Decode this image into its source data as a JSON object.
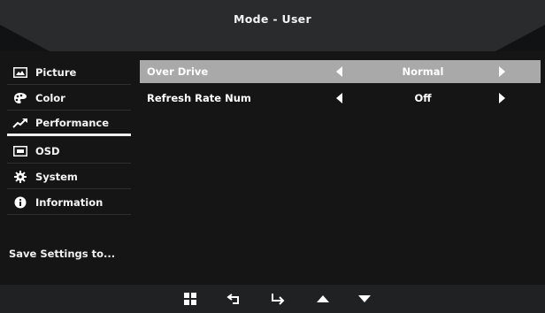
{
  "header": {
    "title": "Mode - User"
  },
  "sidebar": {
    "items": [
      {
        "label": "Picture",
        "icon": "picture-icon"
      },
      {
        "label": "Color",
        "icon": "palette-icon"
      },
      {
        "label": "Performance",
        "icon": "trend-up-icon",
        "active": true
      },
      {
        "label": "OSD",
        "icon": "osd-icon"
      },
      {
        "label": "System",
        "icon": "gear-icon"
      },
      {
        "label": "Information",
        "icon": "info-icon"
      }
    ],
    "save_settings": "Save Settings to..."
  },
  "main": {
    "rows": [
      {
        "label": "Over Drive",
        "value": "Normal",
        "selected": true
      },
      {
        "label": "Refresh Rate Num",
        "value": "Off",
        "selected": false
      }
    ]
  },
  "footer": {
    "buttons": [
      "menu-grid-icon",
      "back-icon",
      "enter-icon",
      "up-arrow-icon",
      "down-arrow-icon"
    ]
  },
  "colors": {
    "background": "#151516",
    "header": "#2b2c2e",
    "selected_row": "#a9a9aa",
    "text": "#ffffff"
  }
}
